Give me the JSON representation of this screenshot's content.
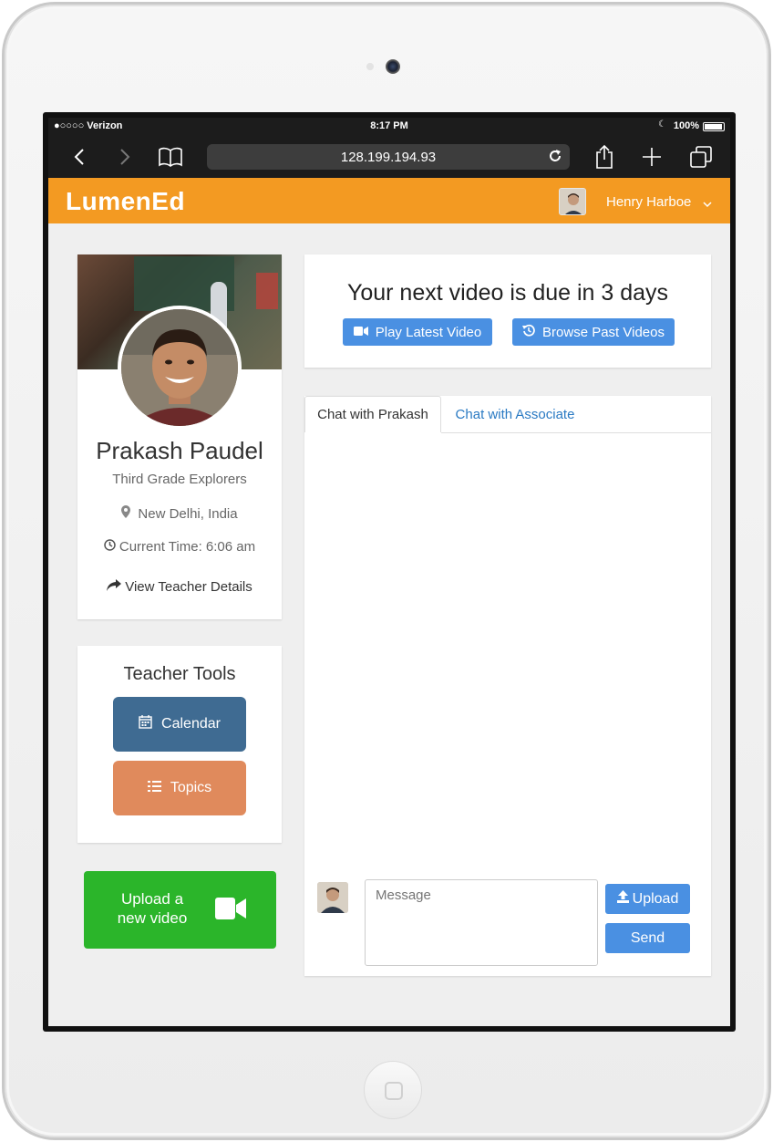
{
  "status_bar": {
    "carrier": "●○○○○ Verizon",
    "time": "8:17 PM",
    "battery": "100%"
  },
  "browser": {
    "url": "128.199.194.93",
    "icons": [
      "back-icon",
      "forward-icon",
      "bookmarks-icon",
      "reload-icon",
      "share-icon",
      "new-tab-icon",
      "tabs-icon"
    ]
  },
  "navbar": {
    "logo": "LumenEd",
    "user_name": "Henry Harboe",
    "brand_color": "#f39a22"
  },
  "profile": {
    "name": "Prakash Paudel",
    "class_name": "Third Grade Explorers",
    "location": "New Delhi, India",
    "current_time": "Current Time: 6:06 am",
    "details_link": "View Teacher Details"
  },
  "teacher_tools": {
    "title": "Teacher Tools",
    "calendar_label": "Calendar",
    "topics_label": "Topics"
  },
  "upload_video": {
    "line1": "Upload a",
    "line2": "new video",
    "color": "#2bb52a"
  },
  "due_panel": {
    "title": "Your next video is due in 3 days",
    "play_label": "Play Latest Video",
    "browse_label": "Browse Past Videos"
  },
  "chat": {
    "tabs": [
      {
        "label": "Chat with Prakash",
        "active": true
      },
      {
        "label": "Chat with Associate",
        "active": false
      }
    ],
    "message_placeholder": "Message",
    "upload_label": "Upload",
    "send_label": "Send"
  }
}
